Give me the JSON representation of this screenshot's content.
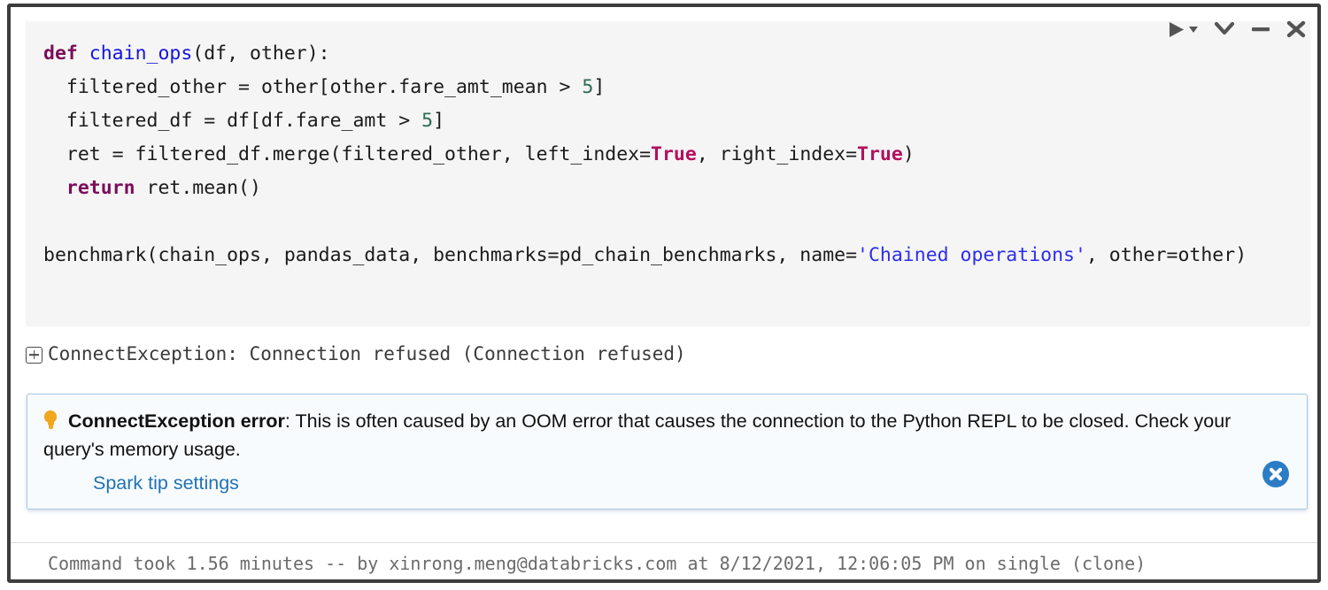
{
  "toolbar": {
    "run_label": "run-cell",
    "run_caret_label": "run-menu",
    "collapse_label": "collapse-cell",
    "minimize_label": "minimize-cell",
    "close_label": "close-cell"
  },
  "code": {
    "line1_kw": "def",
    "line1_fn": "chain_ops",
    "line1_rest": "(df, other):",
    "line2": "  filtered_other = other[other.fare_amt_mean > ",
    "line2_num": "5",
    "line2_end": "]",
    "line3": "  filtered_df = df[df.fare_amt > ",
    "line3_num": "5",
    "line3_end": "]",
    "line4a": "  ret = filtered_df.merge(filtered_other, left_index=",
    "line4_bool1": "True",
    "line4b": ", right_index=",
    "line4_bool2": "True",
    "line4c": ")",
    "line5_kw": "  return",
    "line5_rest": " ret.mean()",
    "line7a": "benchmark(chain_ops, pandas_data, benchmarks=pd_chain_benchmarks, name=",
    "line7_str": "'Chained operations'",
    "line7b": ", other=other)"
  },
  "output": {
    "expand_icon": "plus-square-icon",
    "exception_text": "ConnectException: Connection refused (Connection refused)"
  },
  "tip": {
    "icon": "lightbulb-icon",
    "title": "ConnectException error",
    "body": ": This is often caused by an OOM error that causes the connection to the Python REPL to be closed. Check your query's memory usage.",
    "link_label": "Spark tip settings",
    "close_icon": "close-circle-icon",
    "border_color": "#a9c9e4",
    "background_color": "#f7fbfd",
    "link_color": "#2272b4",
    "bulb_color": "#f0a81e",
    "close_color": "#2b7cc4"
  },
  "footer": {
    "text": "Command took 1.56 minutes -- by xinrong.meng@databricks.com at 8/12/2021, 12:06:05 PM on single (clone)"
  },
  "theme": {
    "code_background": "#f5f5f5",
    "keyword_color": "#7b0d5a",
    "function_color": "#1414e0",
    "number_color": "#2e6b52",
    "boolean_color": "#b3105e",
    "string_color": "#2d2df0",
    "cell_border": "#3c3c3c"
  }
}
